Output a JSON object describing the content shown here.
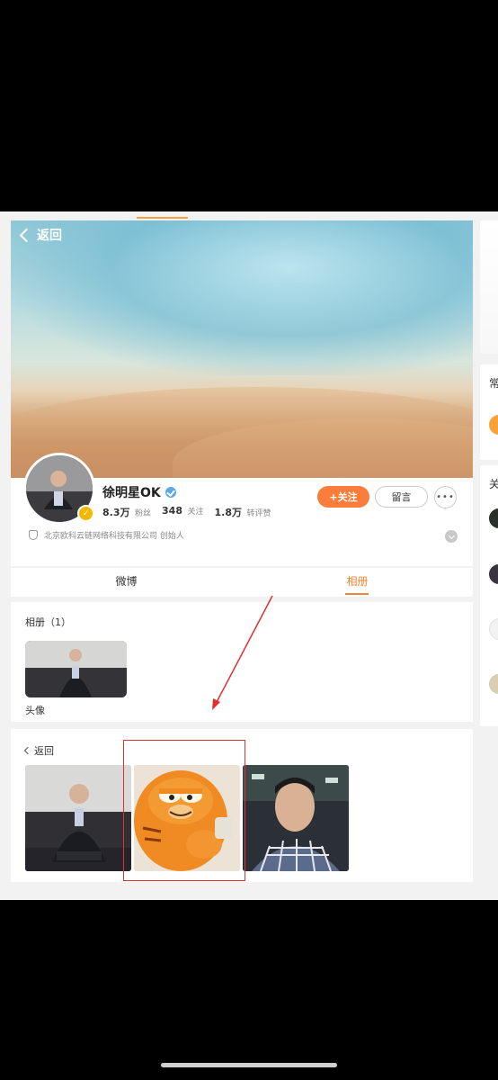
{
  "header": {
    "back_label": "返回"
  },
  "profile": {
    "name": "徐明星OK",
    "stats": [
      {
        "num": "8.3万",
        "label": "粉丝"
      },
      {
        "num": "348",
        "label": "关注"
      },
      {
        "num": "1.8万",
        "label": "转评赞"
      }
    ],
    "follow_label": "+关注",
    "message_label": "留言",
    "more_label": "•••",
    "company": "北京欧科云链网络科技有限公司 创始人"
  },
  "tabs": [
    {
      "label": "微博",
      "active": false
    },
    {
      "label": "相册",
      "active": true
    }
  ],
  "albums": {
    "title": "相册（1）",
    "items": [
      {
        "name": "头像"
      }
    ]
  },
  "photos": {
    "back_label": "返回",
    "items": [
      {
        "name": "man-on-sofa-photo"
      },
      {
        "name": "garfield-cat-photo",
        "highlighted": true
      },
      {
        "name": "selfie-office-photo"
      }
    ]
  },
  "right_column": {
    "chars": [
      "常",
      "关"
    ]
  },
  "colors": {
    "accent": "#f78432",
    "follow_button": "#fa7d3c",
    "highlight": "#e03030",
    "verified": "#5aa9e6"
  }
}
